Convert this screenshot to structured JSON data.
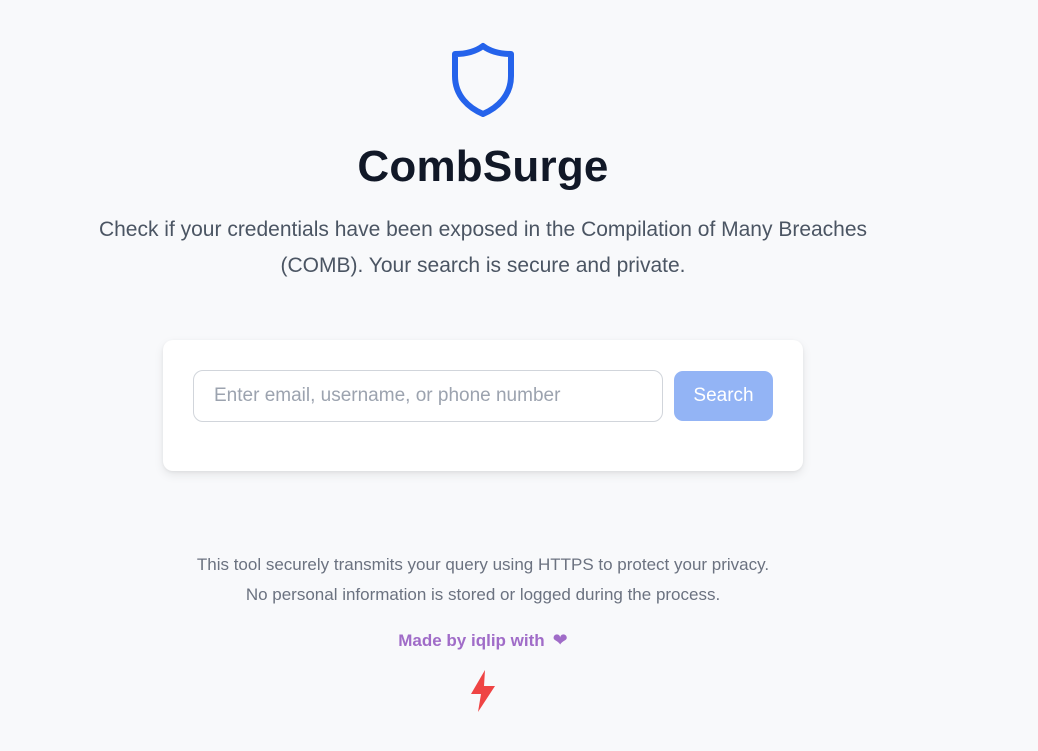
{
  "app": {
    "title": "CombSurge",
    "description": "Check if your credentials have been exposed in the Compilation of Many Breaches (COMB). Your search is secure and private.",
    "icon": "shield-icon"
  },
  "search": {
    "placeholder": "Enter email, username, or phone number",
    "value": "",
    "button_label": "Search"
  },
  "footer": {
    "notice_line1": "This tool securely transmits your query using HTTPS to protect your privacy.",
    "notice_line2": "No personal information is stored or logged during the process.",
    "credit": "Made by iqlip with",
    "credit_icon": "heart-icon",
    "bottom_icon": "lightning-icon"
  },
  "colors": {
    "background": "#f8f9fb",
    "accent": "#2563eb",
    "button": "#93b4f5",
    "credit": "#a06cc8",
    "bolt": "#ef4444"
  }
}
